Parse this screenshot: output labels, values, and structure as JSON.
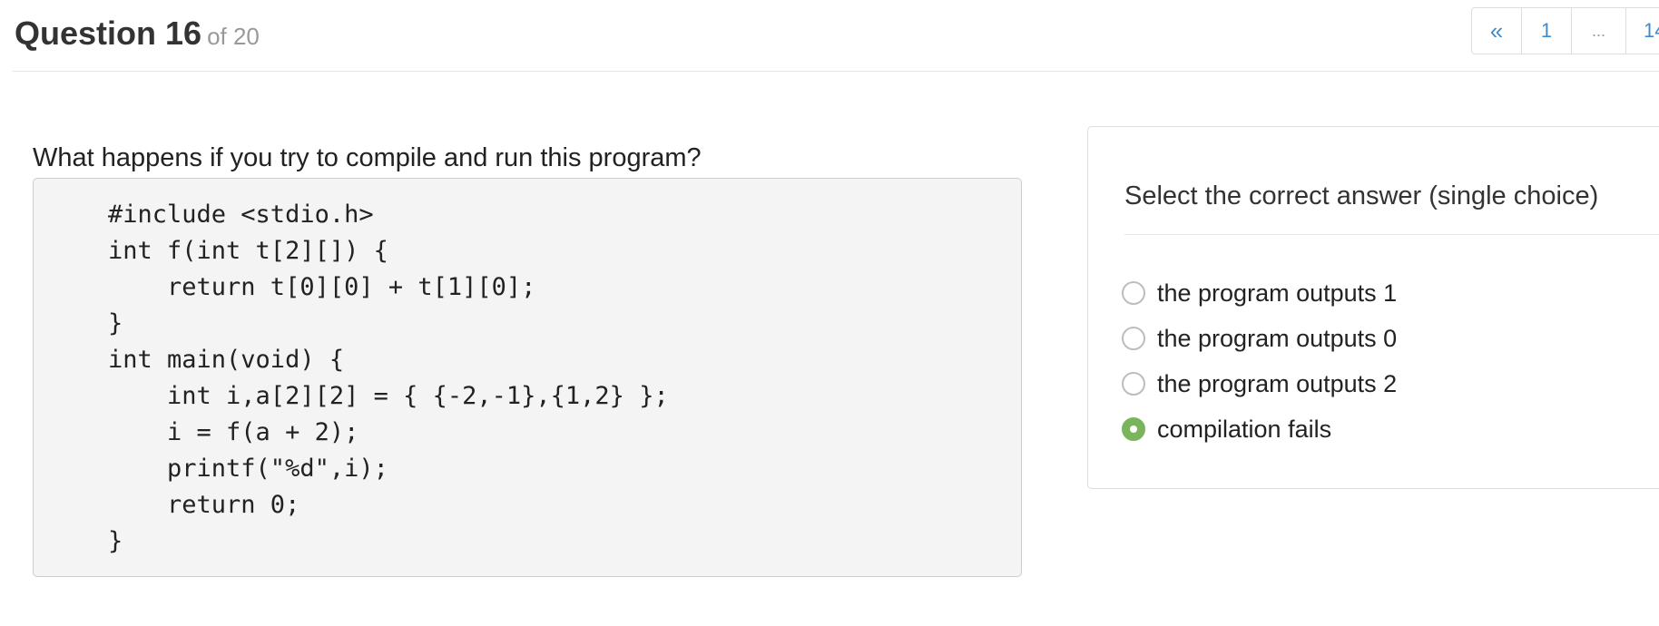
{
  "header": {
    "title": "Question 16",
    "of_label": "of 20"
  },
  "pagination": {
    "prev": "«",
    "first": "1",
    "ellipsis": "...",
    "last": "14"
  },
  "question": {
    "prompt": "What happens if you try to compile and run this program?",
    "code": "#include <stdio.h>\nint f(int t[2][]) {\n    return t[0][0] + t[1][0];\n}\nint main(void) {\n    int i,a[2][2] = { {-2,-1},{1,2} };\n    i = f(a + 2);\n    printf(\"%d\",i);\n    return 0;\n}"
  },
  "answers": {
    "title": "Select the correct answer (single choice)",
    "options": [
      {
        "label": "the program outputs 1",
        "selected": false
      },
      {
        "label": "the program outputs 0",
        "selected": false
      },
      {
        "label": "the program outputs 2",
        "selected": false
      },
      {
        "label": "compilation fails",
        "selected": true
      }
    ],
    "accent_color": "#7ab55c"
  }
}
